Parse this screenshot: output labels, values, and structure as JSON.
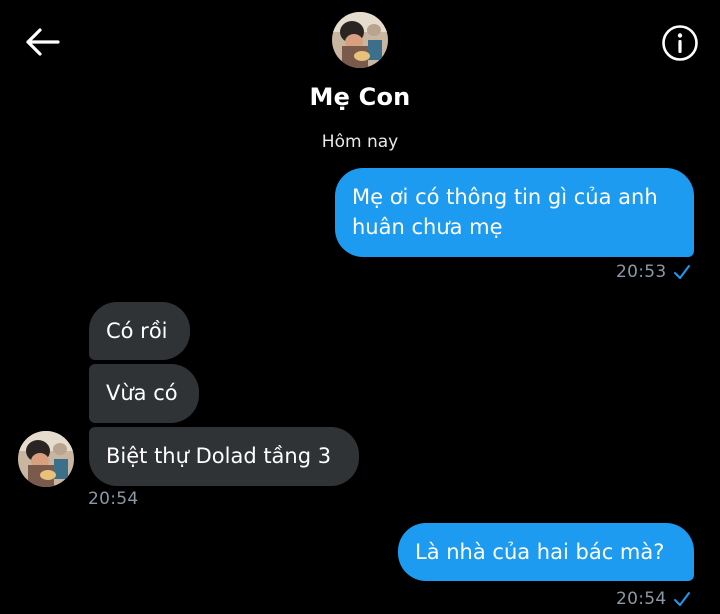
{
  "header": {
    "contact_name": "Mẹ Con",
    "back_icon": "back-arrow-icon",
    "info_icon": "info-icon"
  },
  "conversation": {
    "date_separator": "Hôm nay",
    "messages": [
      {
        "direction": "out",
        "text_line1": "Mẹ ơi có thông tin gì của anh",
        "text_line2": "huân chưa mẹ"
      },
      {
        "direction": "in",
        "text": "Có rồi"
      },
      {
        "direction": "in",
        "text": "Vừa có"
      },
      {
        "direction": "in",
        "text": "Biệt thự Dolad tầng 3"
      },
      {
        "direction": "out",
        "text": "Là nhà của hai bác mà?"
      }
    ],
    "timestamps": {
      "first_out": "20:53",
      "incoming_group": "20:54",
      "last_out": "20:54"
    },
    "read_icon": "check-icon"
  },
  "colors": {
    "background": "#000000",
    "outgoing_bubble": "#1d9bf0",
    "incoming_bubble": "#2f3336",
    "timestamp": "#8b98a5"
  }
}
